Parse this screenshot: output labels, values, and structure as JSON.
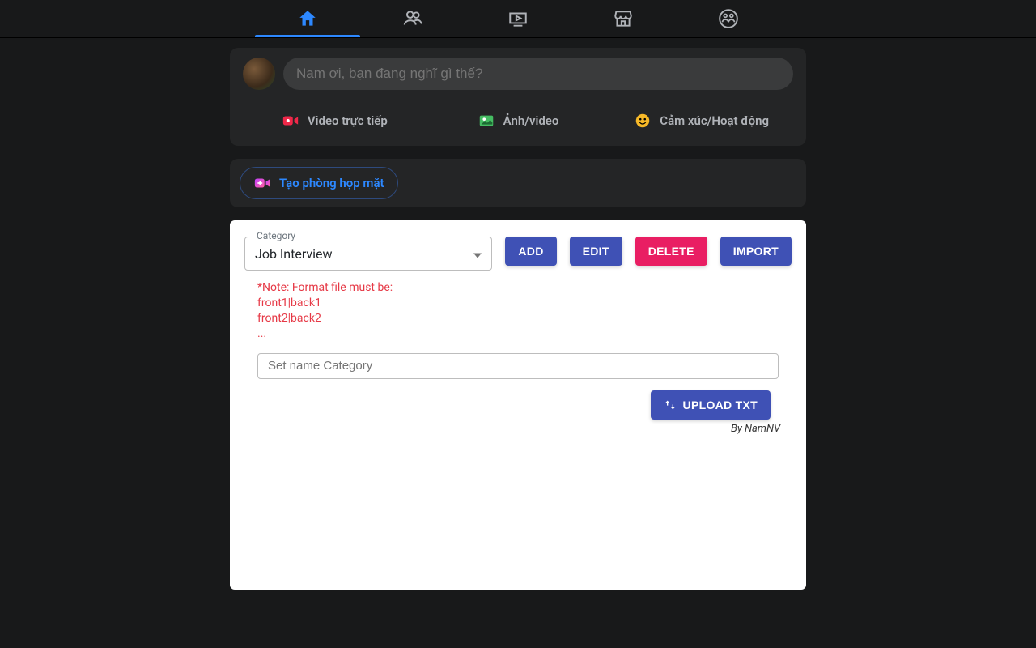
{
  "composer": {
    "placeholder": "Nam ơi, bạn đang nghĩ gì thế?",
    "actions": {
      "live": "Video trực tiếp",
      "photo": "Ảnh/video",
      "feeling": "Cảm xúc/Hoạt động"
    }
  },
  "room": {
    "create": "Tạo phòng họp mặt"
  },
  "card": {
    "category_label": "Category",
    "category_value": "Job Interview",
    "buttons": {
      "add": "ADD",
      "edit": "EDIT",
      "delete": "DELETE",
      "import": "IMPORT",
      "upload": "UPLOAD TXT"
    },
    "note": {
      "l1": "*Note: Format file must be:",
      "l2": "front1|back1",
      "l3": "front2|back2",
      "l4": "..."
    },
    "name_placeholder": "Set name Category",
    "byline": "By NamNV"
  }
}
